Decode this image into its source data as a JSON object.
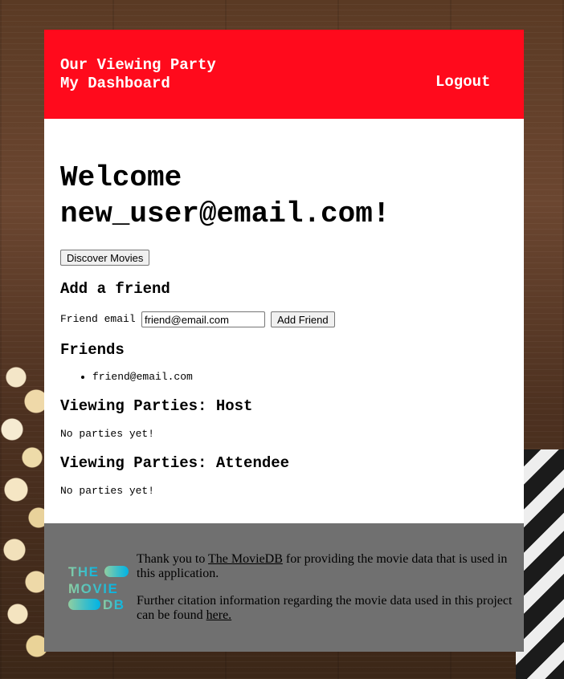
{
  "header": {
    "title": "Our Viewing Party",
    "dashboard_link": "My Dashboard",
    "logout": "Logout"
  },
  "welcome": {
    "heading": "Welcome new_user@email.com!",
    "discover_button": "Discover Movies"
  },
  "add_friend": {
    "heading": "Add a friend",
    "label": "Friend email",
    "input_value": "friend@email.com",
    "button": "Add Friend"
  },
  "friends": {
    "heading": "Friends",
    "items": [
      "friend@email.com"
    ]
  },
  "host_parties": {
    "heading": "Viewing Parties: Host",
    "empty_text": "No parties yet!"
  },
  "attendee_parties": {
    "heading": "Viewing Parties: Attendee",
    "empty_text": "No parties yet!"
  },
  "footer": {
    "thanks_prefix": "Thank you to ",
    "moviedb_link": "The MovieDB",
    "thanks_suffix": " for providing the movie data that is used in this application.",
    "citation_prefix": "Further citation information regarding the movie data used in this project can be found ",
    "citation_link": "here.",
    "logo": {
      "line1": "THE",
      "line2": "MOVIE",
      "line3": "DB",
      "colors": {
        "start": "#90cea1",
        "mid": "#3cbec9",
        "end": "#00b3e5"
      }
    }
  }
}
